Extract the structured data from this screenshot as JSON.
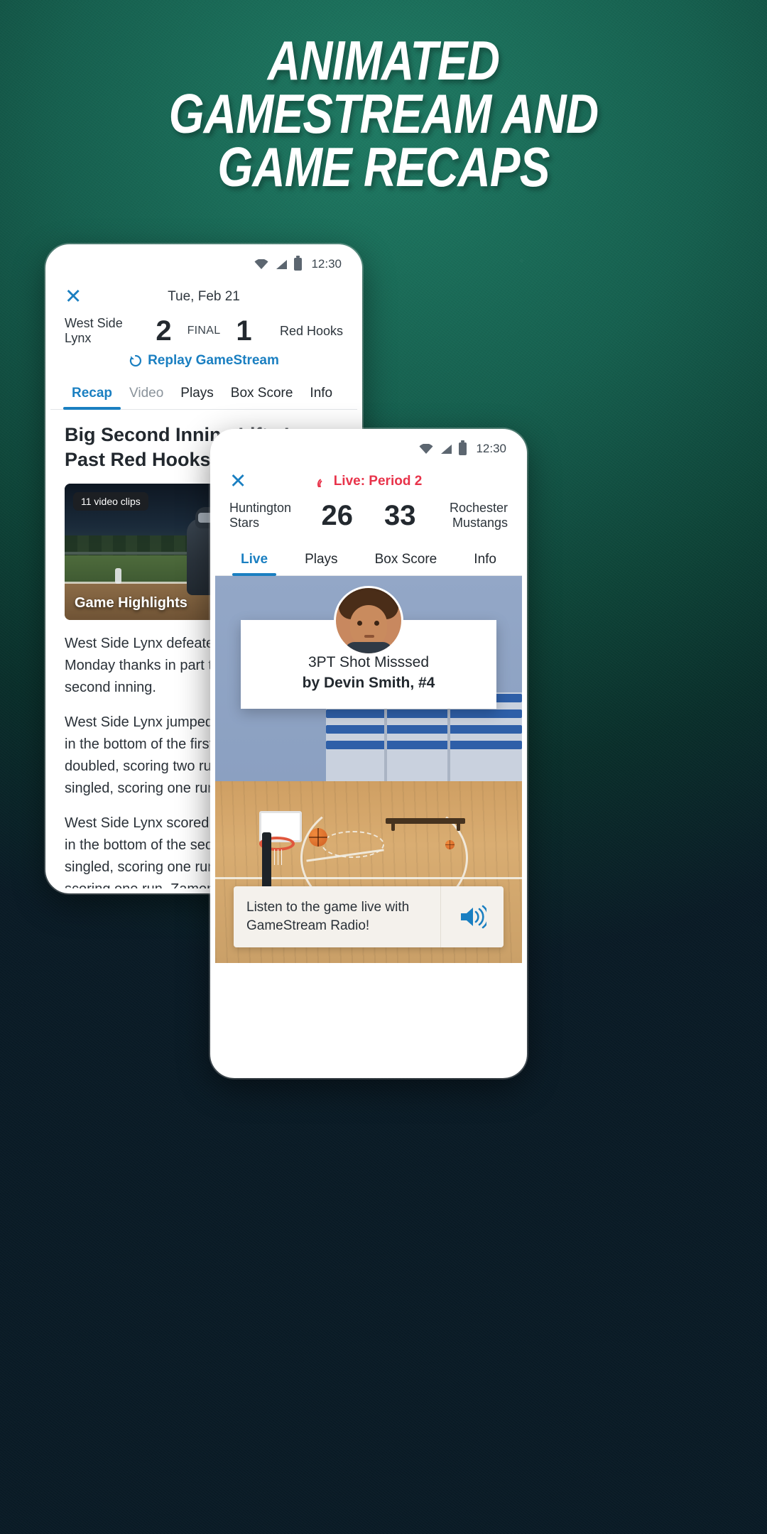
{
  "headline": {
    "line1": "ANIMATED",
    "line2": "GAMESTREAM AND",
    "line3": "GAME RECAPS"
  },
  "colors": {
    "background_green": "#14705c",
    "background_dark": "#0a1622",
    "accent_blue": "#1a7fc1",
    "live_red": "#e8334a",
    "text_dark": "#22282e"
  },
  "phone_recap": {
    "status_bar": {
      "wifi_icon": "wifi-icon",
      "signal_icon": "signal-icon",
      "battery_icon": "battery-icon",
      "clock": "12:30"
    },
    "close_icon": "close-icon",
    "date": "Tue, Feb 21",
    "score": {
      "home_team": "West Side Lynx",
      "home_score": "2",
      "status": "FINAL",
      "away_score": "1",
      "away_team": "Red Hooks"
    },
    "replay_link": "Replay GameStream",
    "replay_icon": "replay-icon",
    "tabs": [
      {
        "label": "Recap",
        "state": "active"
      },
      {
        "label": "Video",
        "state": "muted"
      },
      {
        "label": "Plays",
        "state": "normal"
      },
      {
        "label": "Box Score",
        "state": "normal"
      },
      {
        "label": "Info",
        "state": "normal"
      }
    ],
    "article": {
      "headline": "Big Second Inning Lifts Lynx Past Red Hooks",
      "video_badge": "11 video clips",
      "video_title": "Game Highlights",
      "paragraph1": "West Side Lynx defeated Red Hooks 2-1 on Monday thanks in part to six runs in the second inning.",
      "paragraph2": "West Side Lynx jumped out to an early lead in the bottom of the first inning after Adams doubled, scoring two runs, and Sarah Jones singled, scoring one run.",
      "paragraph3": "West Side Lynx scored six runs on five hits in the bottom of the second inning. Martinez singled, scoring one run, Mendoza doubled, scoring one run, Zamora tripled, scoring two runs, and Candela Beistegui homered."
    }
  },
  "phone_live": {
    "status_bar": {
      "wifi_icon": "wifi-icon",
      "signal_icon": "signal-icon",
      "battery_icon": "battery-icon",
      "clock": "12:30"
    },
    "close_icon": "close-icon",
    "live_icon": "broadcast-icon",
    "live_label": "Live:  Period 2",
    "score": {
      "home_team": "Huntington Stars",
      "home_score": "26",
      "away_score": "33",
      "away_team": "Rochester Mustangs"
    },
    "tabs": [
      {
        "label": "Live",
        "state": "active"
      },
      {
        "label": "Plays",
        "state": "normal"
      },
      {
        "label": "Box Score",
        "state": "normal"
      },
      {
        "label": "Info",
        "state": "normal"
      }
    ],
    "play_card": {
      "avatar_icon": "player-avatar",
      "line1": "3PT Shot Misssed",
      "line2": "by Devin Smith, #4"
    },
    "radio_banner": {
      "text": "Listen to the game live with GameStream Radio!",
      "speaker_icon": "speaker-icon"
    }
  }
}
